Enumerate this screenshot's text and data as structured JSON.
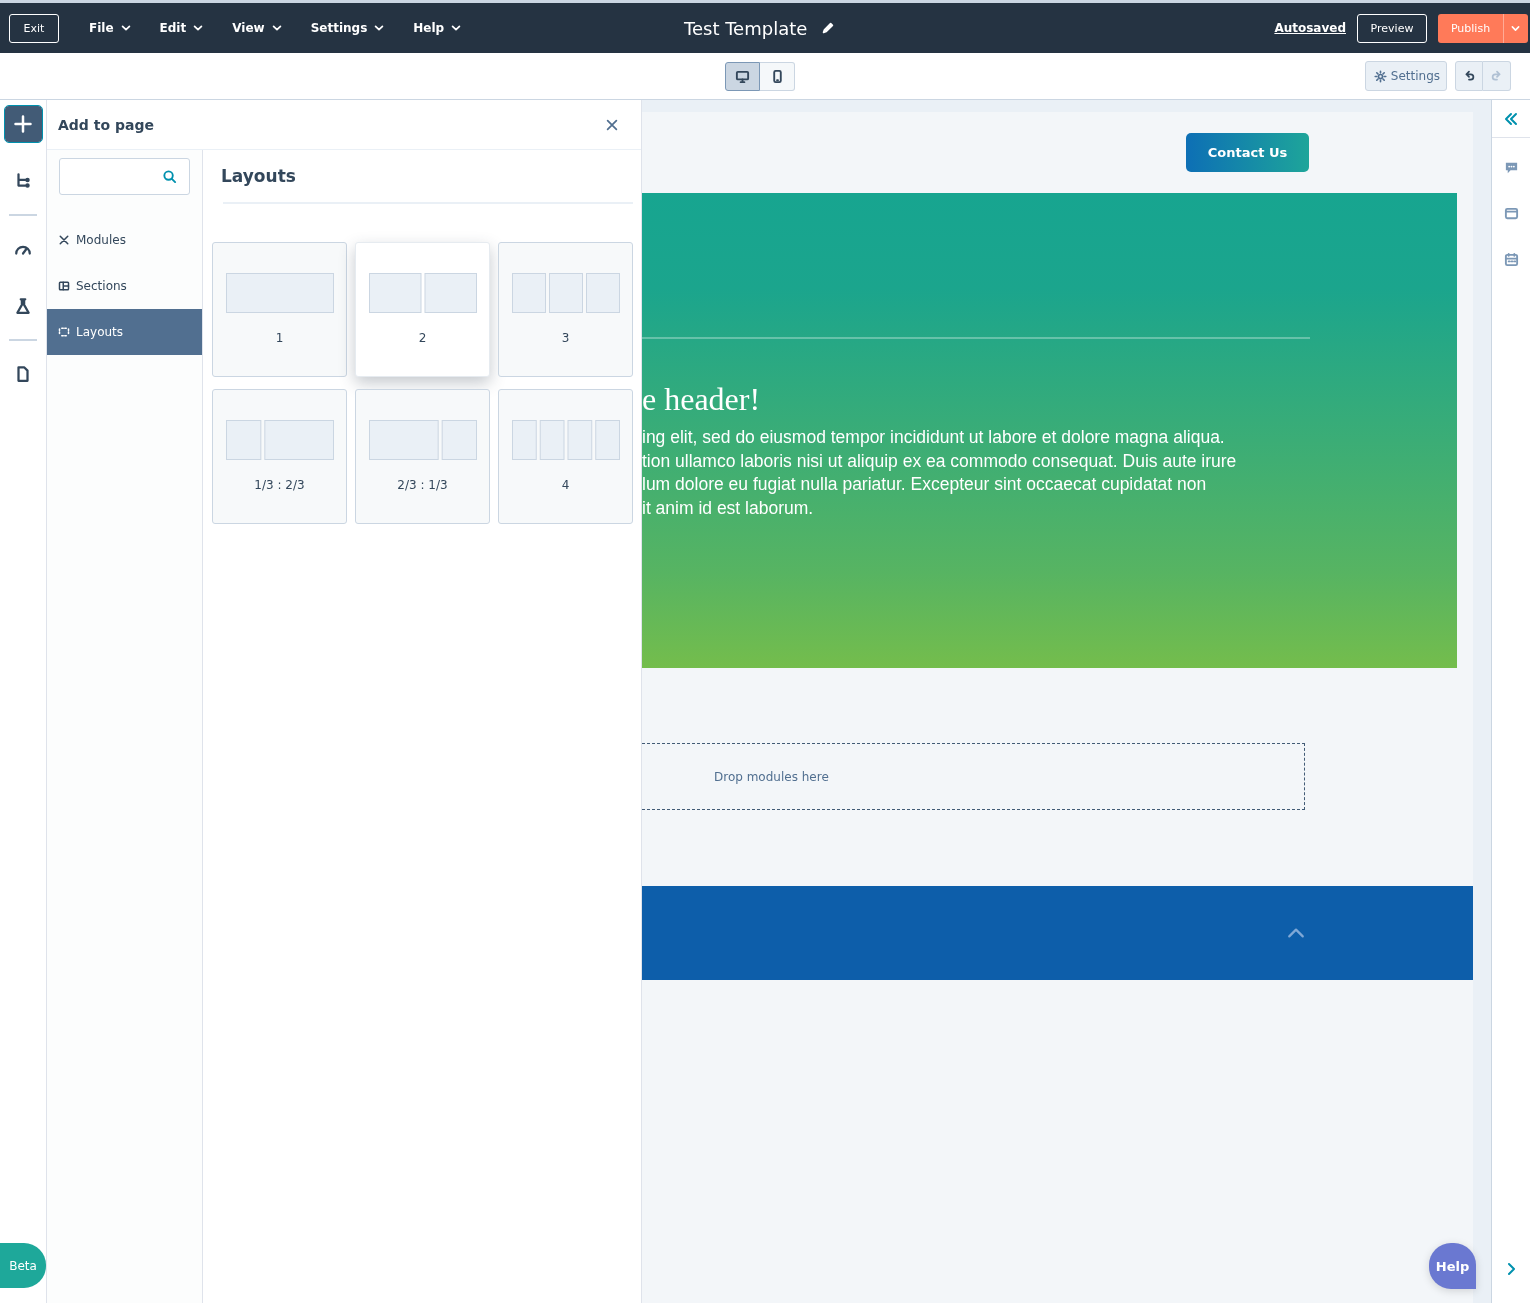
{
  "topbar": {
    "exit": "Exit",
    "menus": [
      {
        "label": "File"
      },
      {
        "label": "Edit"
      },
      {
        "label": "View"
      },
      {
        "label": "Settings"
      },
      {
        "label": "Help"
      }
    ],
    "title": "Test Template",
    "autosaved": "Autosaved",
    "preview": "Preview",
    "publish": "Publish"
  },
  "toolbar": {
    "devices": [
      {
        "kind": "desktop",
        "selected": true
      },
      {
        "kind": "mobile",
        "selected": false
      }
    ],
    "settings": "Settings",
    "undo": {
      "disabled": false
    },
    "redo": {
      "disabled": true
    }
  },
  "left_rail": [
    {
      "kind": "add",
      "selected": true
    },
    {
      "kind": "tree",
      "selected": false
    },
    {
      "kind": "divider"
    },
    {
      "kind": "gauge",
      "selected": false
    },
    {
      "kind": "flask",
      "selected": false
    },
    {
      "kind": "divider"
    },
    {
      "kind": "page",
      "selected": false
    }
  ],
  "panel": {
    "title": "Add to page",
    "nav": [
      {
        "kind": "modules",
        "label": "Modules",
        "selected": false
      },
      {
        "kind": "sections",
        "label": "Sections",
        "selected": false
      },
      {
        "kind": "layouts",
        "label": "Layouts",
        "selected": true
      }
    ],
    "heading": "Layouts",
    "layouts": [
      {
        "kind": "one",
        "label": "1",
        "hovered": false
      },
      {
        "kind": "two",
        "label": "2",
        "hovered": true
      },
      {
        "kind": "three",
        "label": "3",
        "hovered": false
      },
      {
        "kind": "third-twothirds",
        "label": "1/3 : 2/3",
        "hovered": false
      },
      {
        "kind": "twothirds-third",
        "label": "2/3 : 1/3",
        "hovered": false
      },
      {
        "kind": "four",
        "label": "4",
        "hovered": false
      }
    ]
  },
  "page": {
    "contact": "Contact Us",
    "heading": "e header!",
    "body": "ing elit, sed do eiusmod tempor incididunt ut labore et dolore magna aliqua.\ntion ullamco laboris nisi ut aliquip ex ea commodo consequat. Duis aute irure\nlum dolore eu fugiat nulla pariatur. Excepteur sint occaecat cupidatat non\nit anim id est laborum.",
    "drop": "Drop modules here"
  },
  "right_rail": [
    {
      "kind": "comments"
    },
    {
      "kind": "window"
    },
    {
      "kind": "calendar"
    }
  ],
  "beta": "Beta",
  "help": "Help"
}
